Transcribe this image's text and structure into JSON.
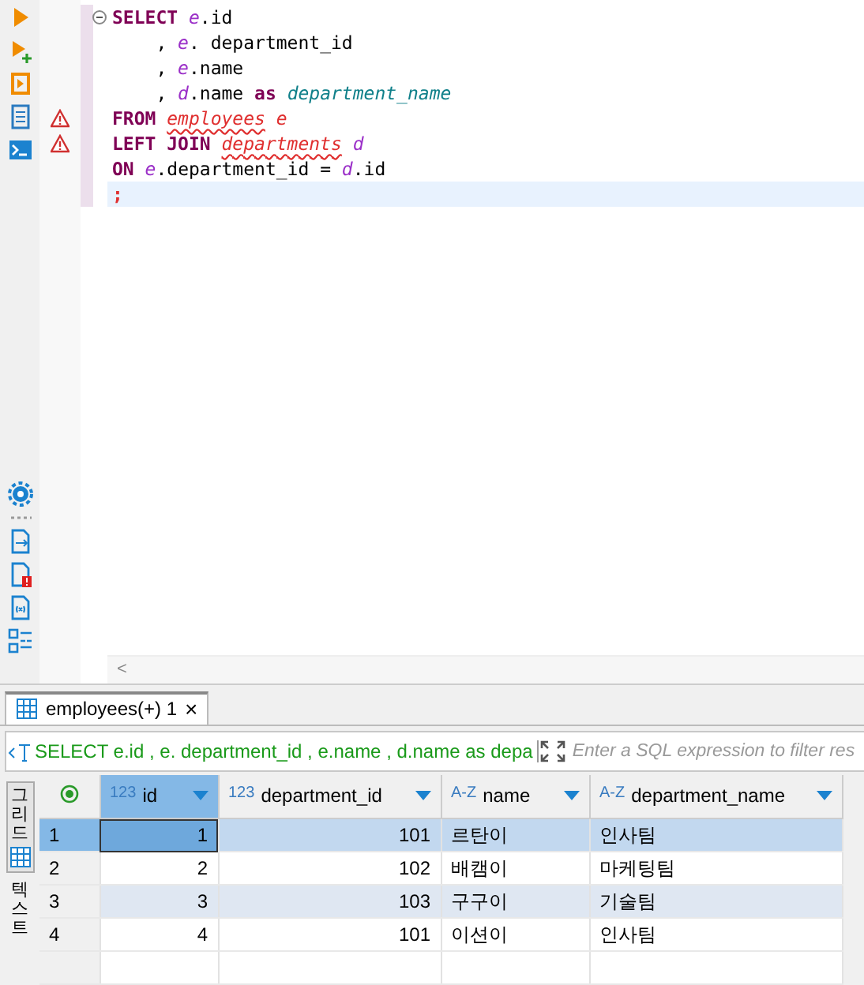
{
  "editor": {
    "lines": [
      {
        "warning": false,
        "fold": true,
        "current": false,
        "tokens": [
          {
            "kind": "keyword",
            "text": "SELECT "
          },
          {
            "kind": "alias",
            "text": "e"
          },
          {
            "kind": "plain",
            "text": ".id"
          }
        ]
      },
      {
        "warning": false,
        "fold": false,
        "current": false,
        "tokens": [
          {
            "kind": "plain",
            "text": "    , "
          },
          {
            "kind": "alias",
            "text": "e"
          },
          {
            "kind": "plain",
            "text": ". department_id"
          }
        ]
      },
      {
        "warning": false,
        "fold": false,
        "current": false,
        "tokens": [
          {
            "kind": "plain",
            "text": "    , "
          },
          {
            "kind": "alias",
            "text": "e"
          },
          {
            "kind": "plain",
            "text": ".name"
          }
        ]
      },
      {
        "warning": false,
        "fold": false,
        "current": false,
        "tokens": [
          {
            "kind": "plain",
            "text": "    , "
          },
          {
            "kind": "alias",
            "text": "d"
          },
          {
            "kind": "plain",
            "text": ".name "
          },
          {
            "kind": "keyword",
            "text": "as "
          },
          {
            "kind": "label",
            "text": "department_name"
          }
        ]
      },
      {
        "warning": true,
        "fold": false,
        "current": false,
        "tokens": [
          {
            "kind": "keyword",
            "text": "FROM "
          },
          {
            "kind": "table",
            "text": "employees"
          },
          {
            "kind": "tablealias",
            "text": " e"
          }
        ]
      },
      {
        "warning": true,
        "fold": false,
        "current": false,
        "tokens": [
          {
            "kind": "keyword",
            "text": "LEFT JOIN "
          },
          {
            "kind": "table",
            "text": "departments"
          },
          {
            "kind": "alias",
            "text": " d"
          }
        ]
      },
      {
        "warning": false,
        "fold": false,
        "current": false,
        "tokens": [
          {
            "kind": "keyword",
            "text": "ON "
          },
          {
            "kind": "alias",
            "text": "e"
          },
          {
            "kind": "plain",
            "text": ".department_id = "
          },
          {
            "kind": "alias",
            "text": "d"
          },
          {
            "kind": "plain",
            "text": ".id"
          }
        ]
      },
      {
        "warning": false,
        "fold": false,
        "current": true,
        "tokens": [
          {
            "kind": "punct",
            "text": ";"
          }
        ]
      }
    ],
    "scroll_left": "<"
  },
  "results": {
    "tab": {
      "label": "employees(+) 1",
      "close": "×"
    },
    "filter": {
      "query": "SELECT e.id , e. department_id , e.name , d.name as depa",
      "placeholder": "Enter a SQL expression to filter res"
    },
    "side_tabs": [
      {
        "label": "그리드",
        "selected": true
      },
      {
        "label": "텍스트",
        "selected": false
      }
    ],
    "columns": [
      {
        "type_icon": "123",
        "name": "id",
        "selected": true
      },
      {
        "type_icon": "123",
        "name": "department_id",
        "selected": false
      },
      {
        "type_icon": "A-Z",
        "name": "name",
        "selected": false
      },
      {
        "type_icon": "A-Z",
        "name": "department_name",
        "selected": false
      }
    ],
    "rows": [
      {
        "num": "1",
        "selected": true,
        "cells": [
          "1",
          "101",
          "르탄이",
          "인사팀"
        ]
      },
      {
        "num": "2",
        "selected": false,
        "cells": [
          "2",
          "102",
          "배캠이",
          "마케팅팀"
        ]
      },
      {
        "num": "3",
        "selected": false,
        "cells": [
          "3",
          "103",
          "구구이",
          "기술팀"
        ]
      },
      {
        "num": "4",
        "selected": false,
        "cells": [
          "4",
          "101",
          "이션이",
          "인사팀"
        ]
      }
    ]
  }
}
